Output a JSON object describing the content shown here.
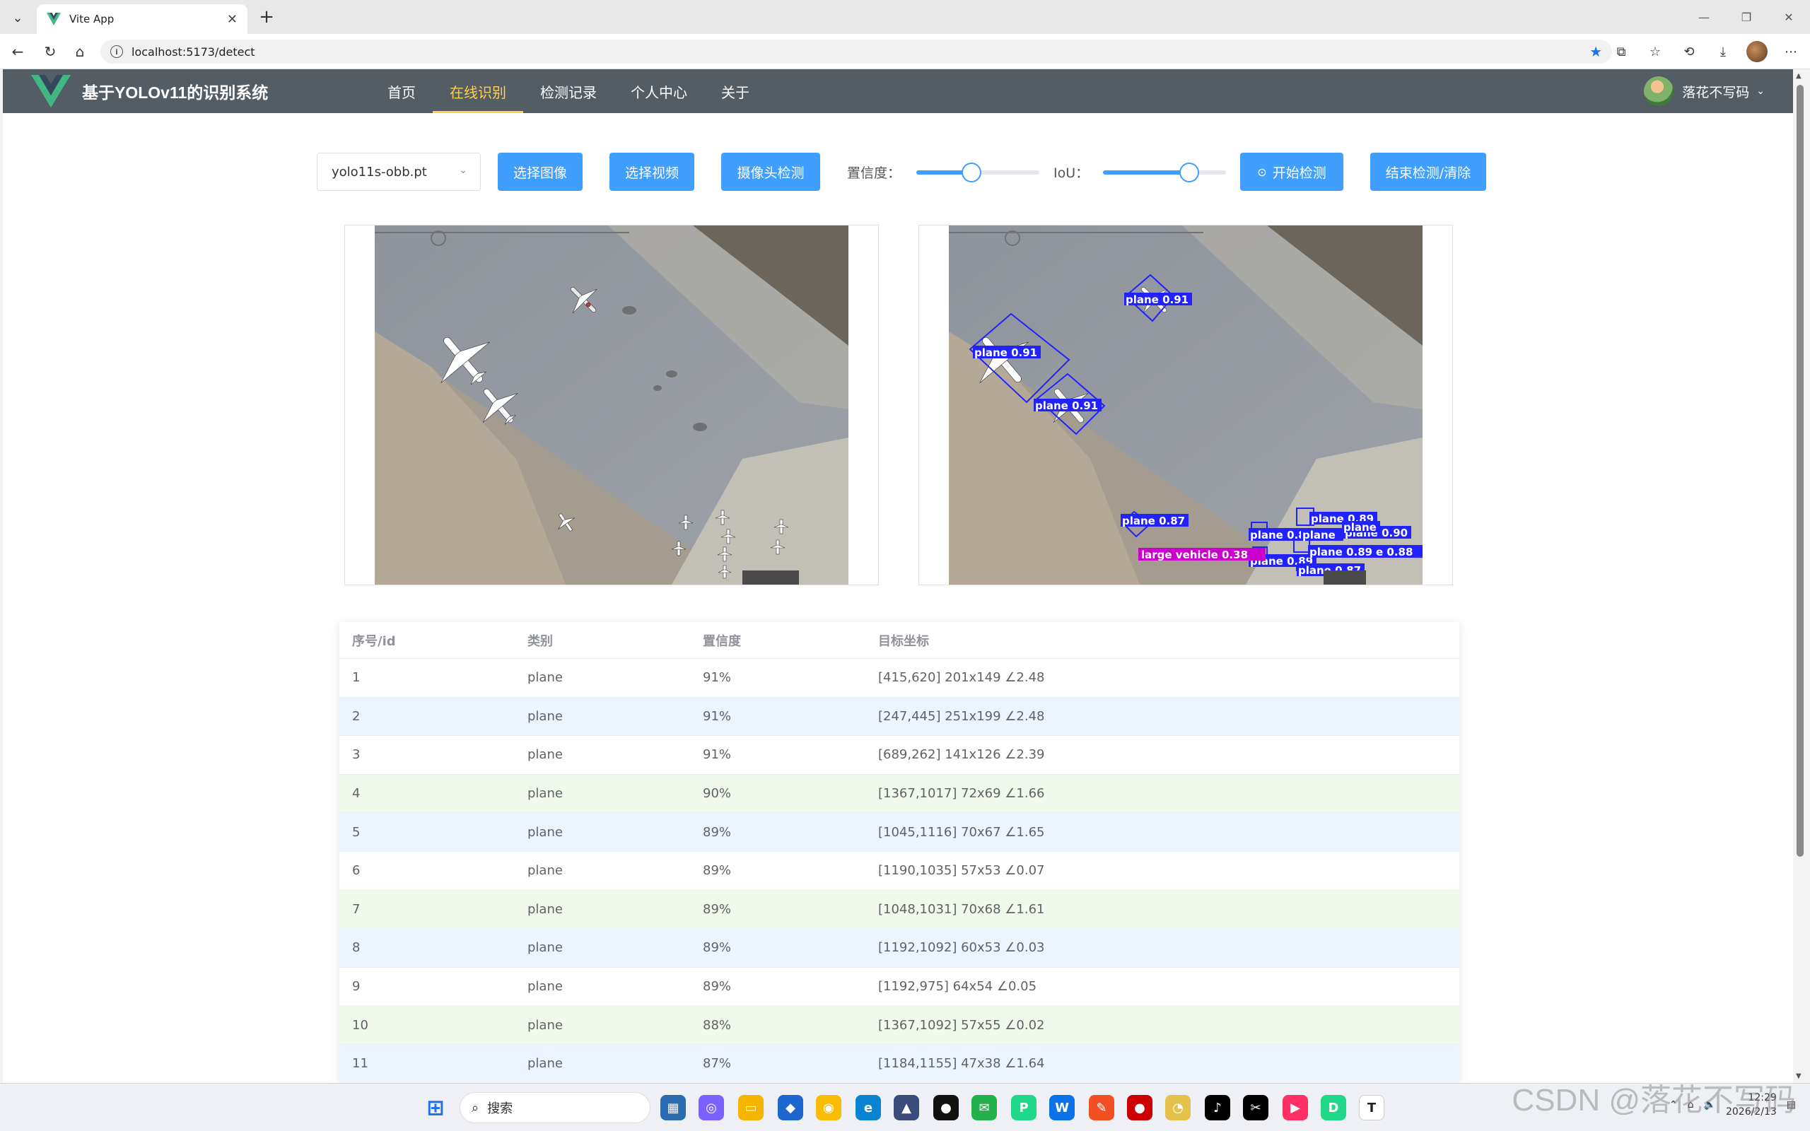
{
  "browser": {
    "tab_title": "Vite App",
    "url": "localhost:5173/detect"
  },
  "app": {
    "title": "基于YOLOv11的识别系统",
    "menu": [
      {
        "label": "首页"
      },
      {
        "label": "在线识别"
      },
      {
        "label": "检测记录"
      },
      {
        "label": "个人中心"
      },
      {
        "label": "关于"
      }
    ],
    "active_menu": "在线识别",
    "username": "落花不写码"
  },
  "controls": {
    "model": "yolo11s-obb.pt",
    "select_image": "选择图像",
    "select_video": "选择视频",
    "camera": "摄像头检测",
    "confidence_label": "置信度：",
    "confidence_value": 0.45,
    "iou_label": "IoU：",
    "iou_value": 0.7,
    "start": "开始检测",
    "stop": "结束检测/清除"
  },
  "detections_overlay": [
    {
      "label": "plane 0.91"
    },
    {
      "label": "plane 0.91"
    },
    {
      "label": "plane 0.91"
    },
    {
      "label": "plane 0.87"
    },
    {
      "label": "plane 0.89"
    },
    {
      "label": "plane 0.90"
    },
    {
      "label": "plane 0.8"
    },
    {
      "label": "plane"
    },
    {
      "label": "plane"
    },
    {
      "label": "plane 0.89"
    },
    {
      "label": "plane 0.89"
    },
    {
      "label": "e 0.88"
    },
    {
      "label": "plane 0.87"
    },
    {
      "label": "large vehicle 0.38"
    }
  ],
  "table": {
    "headers": [
      "序号/id",
      "类别",
      "置信度",
      "目标坐标"
    ],
    "rows": [
      {
        "id": "1",
        "cls": "plane",
        "conf": "91%",
        "coord": "[415,620] 201x149 ∠2.48"
      },
      {
        "id": "2",
        "cls": "plane",
        "conf": "91%",
        "coord": "[247,445] 251x199 ∠2.48"
      },
      {
        "id": "3",
        "cls": "plane",
        "conf": "91%",
        "coord": "[689,262] 141x126 ∠2.39"
      },
      {
        "id": "4",
        "cls": "plane",
        "conf": "90%",
        "coord": "[1367,1017] 72x69 ∠1.66"
      },
      {
        "id": "5",
        "cls": "plane",
        "conf": "89%",
        "coord": "[1045,1116] 70x67 ∠1.65"
      },
      {
        "id": "6",
        "cls": "plane",
        "conf": "89%",
        "coord": "[1190,1035] 57x53 ∠0.07"
      },
      {
        "id": "7",
        "cls": "plane",
        "conf": "89%",
        "coord": "[1048,1031] 70x68 ∠1.61"
      },
      {
        "id": "8",
        "cls": "plane",
        "conf": "89%",
        "coord": "[1192,1092] 60x53 ∠0.03"
      },
      {
        "id": "9",
        "cls": "plane",
        "conf": "89%",
        "coord": "[1192,975] 64x54 ∠0.05"
      },
      {
        "id": "10",
        "cls": "plane",
        "conf": "88%",
        "coord": "[1367,1092] 57x55 ∠0.02"
      },
      {
        "id": "11",
        "cls": "plane",
        "conf": "87%",
        "coord": "[1184,1155] 47x38 ∠1.64"
      }
    ]
  },
  "taskbar": {
    "search_placeholder": "搜索",
    "time": "12:29",
    "date": "2026/2/13",
    "watermark": "CSDN @落花不写码"
  },
  "colors": {
    "header_bg": "#545c64",
    "active_menu": "#ffd04b",
    "primary": "#409eff",
    "row_blue": "#ecf5ff",
    "row_green": "#f0f9eb",
    "box_blue": "#2222ff",
    "box_magenta": "#cc00cc"
  }
}
